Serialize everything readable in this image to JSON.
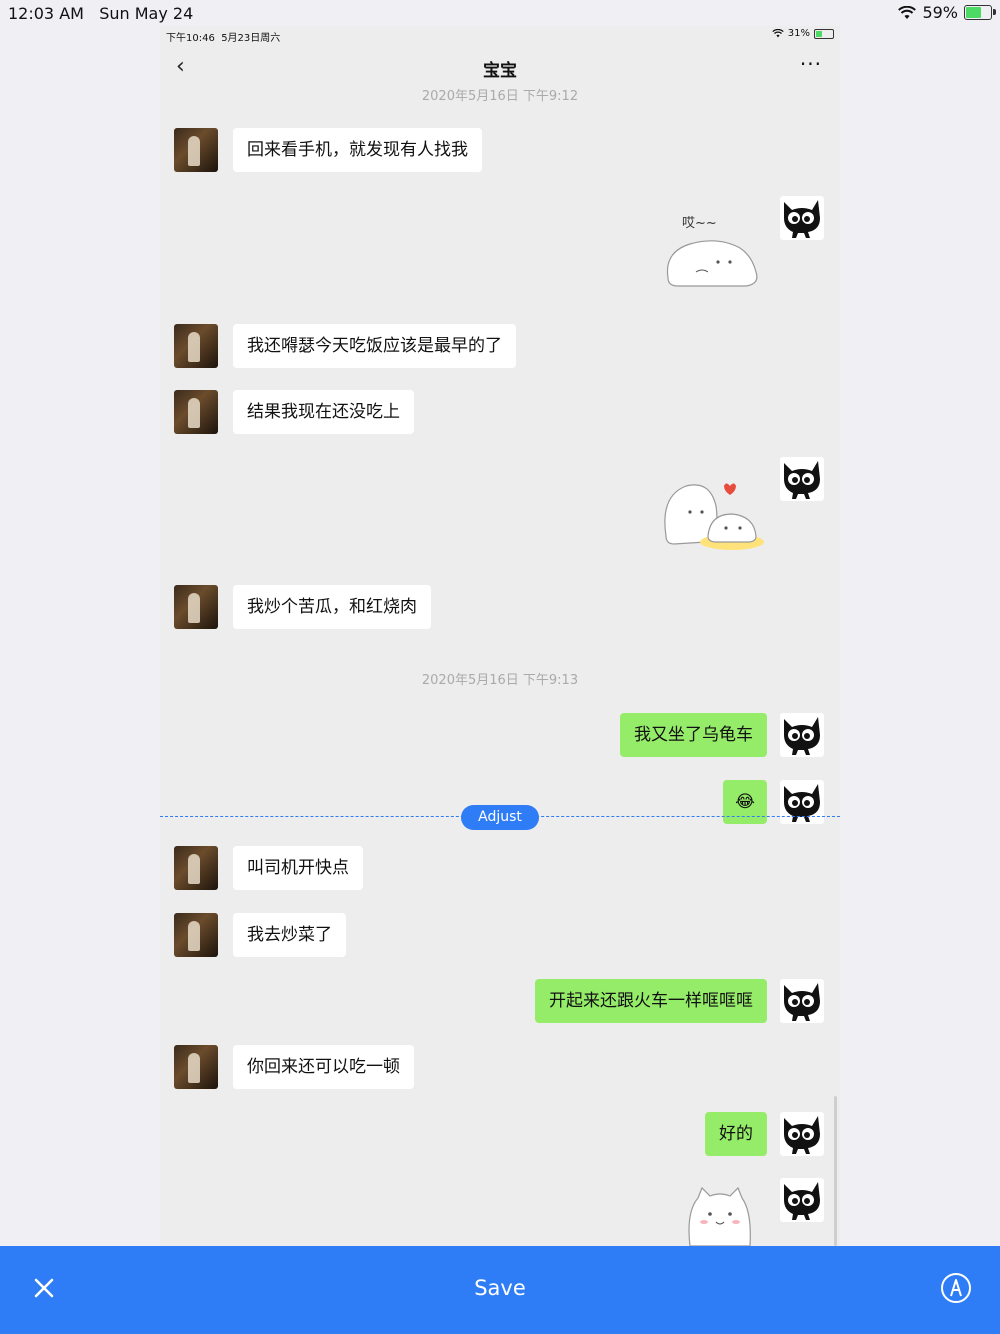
{
  "ipad_status": {
    "time": "12:03 AM",
    "date": "Sun May 24",
    "battery": "59%",
    "battery_level": 0.59
  },
  "phone_status": {
    "time": "下午10:46",
    "date": "5月23日周六",
    "battery": "31%",
    "battery_level": 0.31
  },
  "nav": {
    "back_icon": "chevron-left-icon",
    "title": "宝宝",
    "more_icon": "ellipsis-icon"
  },
  "timestamps": [
    "2020年5月16日 下午9:12",
    "2020年5月16日 下午9:13"
  ],
  "messages": [
    {
      "from": "other",
      "text": "回来看手机，就发现有人找我"
    },
    {
      "from": "me",
      "sticker": "sigh-cat-sticker",
      "sticker_text": "哎~~"
    },
    {
      "from": "other",
      "text": "我还嘚瑟今天吃饭应该是最早的了"
    },
    {
      "from": "other",
      "text": "结果我现在还没吃上"
    },
    {
      "from": "me",
      "sticker": "cats-hugging-sticker"
    },
    {
      "from": "other",
      "text": "我炒个苦瓜，和红烧肉"
    },
    {
      "from": "me",
      "text": "我又坐了乌龟车"
    },
    {
      "from": "me",
      "emoji": "😂"
    },
    {
      "from": "other",
      "text": "叫司机开快点"
    },
    {
      "from": "other",
      "text": "我去炒菜了"
    },
    {
      "from": "me",
      "text": "开起来还跟火车一样哐哐哐"
    },
    {
      "from": "other",
      "text": "你回来还可以吃一顿"
    },
    {
      "from": "me",
      "text": "好的"
    },
    {
      "from": "me",
      "sticker": "cat-sticker"
    }
  ],
  "editor": {
    "adjust_label": "Adjust",
    "save_label": "Save",
    "close_icon": "close-icon",
    "markup_icon": "markup-pen-icon"
  },
  "colors": {
    "accent": "#2f7df6",
    "my_bubble": "#95ec69",
    "other_bubble": "#ffffff",
    "chat_bg": "#ededed"
  }
}
